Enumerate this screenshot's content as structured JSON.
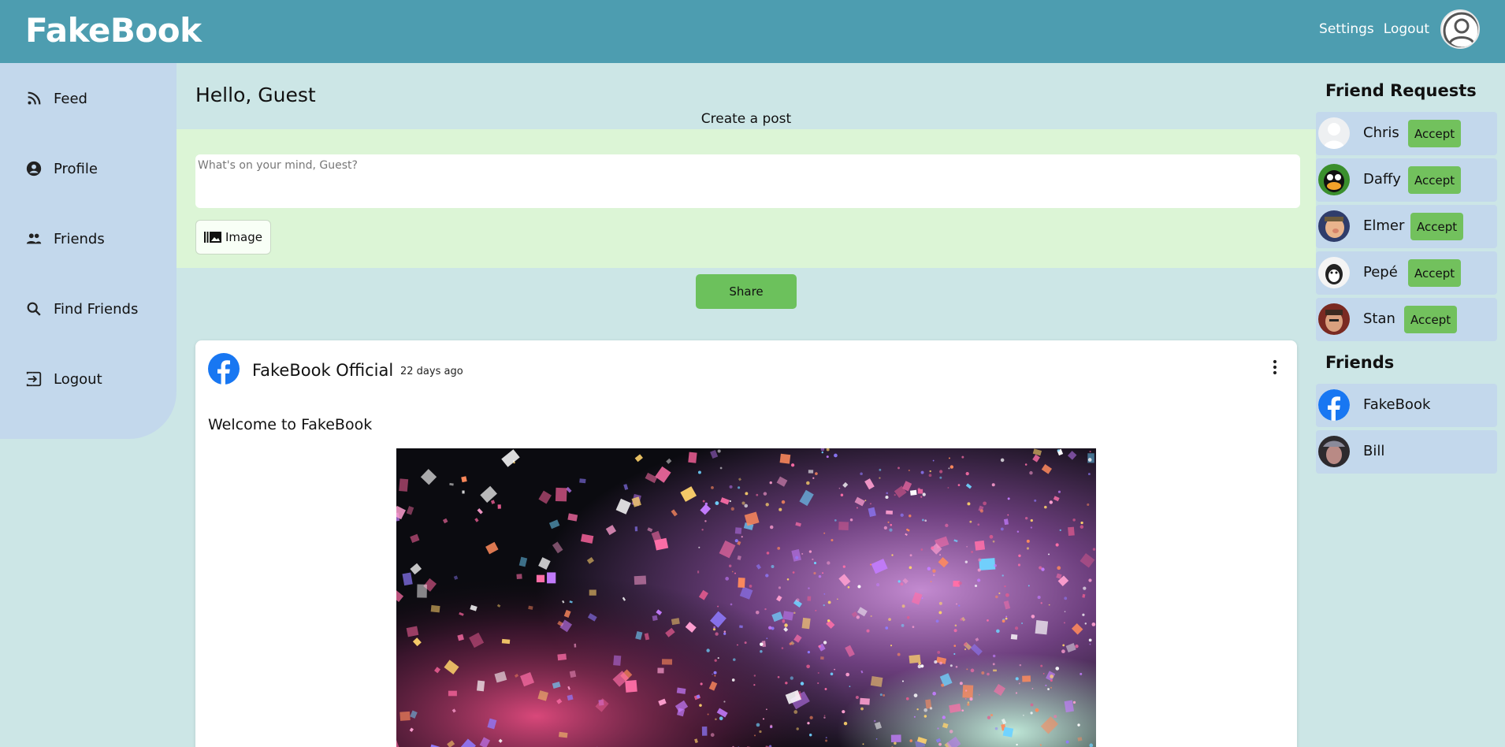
{
  "header": {
    "logo": "FakeBook",
    "links": {
      "settings": "Settings",
      "logout": "Logout"
    },
    "avatar_icon": "user-avatar-icon"
  },
  "sidebar": {
    "items": [
      {
        "label": "Feed",
        "icon": "rss-icon"
      },
      {
        "label": "Profile",
        "icon": "account-circle-icon"
      },
      {
        "label": "Friends",
        "icon": "people-icon"
      },
      {
        "label": "Find Friends",
        "icon": "search-icon"
      },
      {
        "label": "Logout",
        "icon": "logout-icon"
      }
    ]
  },
  "main": {
    "greeting": "Hello, Guest",
    "create_label": "Create a post",
    "composer": {
      "placeholder": "What's on your mind, Guest?",
      "value": "",
      "image_button": "Image",
      "share_button": "Share"
    },
    "post": {
      "author": "FakeBook Official",
      "time": "22 days ago",
      "text": "Welcome to FakeBook",
      "image_alt": "confetti celebration photo"
    }
  },
  "right": {
    "requests_title": "Friend Requests",
    "accept_label": "Accept",
    "requests": [
      {
        "name": "Chris"
      },
      {
        "name": "Daffy"
      },
      {
        "name": "Elmer"
      },
      {
        "name": "Pepé"
      },
      {
        "name": "Stan"
      }
    ],
    "friends_title": "Friends",
    "friends": [
      {
        "name": "FakeBook"
      },
      {
        "name": "Bill"
      }
    ]
  },
  "colors": {
    "header": "#4d9db0",
    "background": "#cce6e6",
    "sidebar": "#c3d8ec",
    "composer": "#dcf5d6",
    "accent_green": "#6cc15c"
  }
}
